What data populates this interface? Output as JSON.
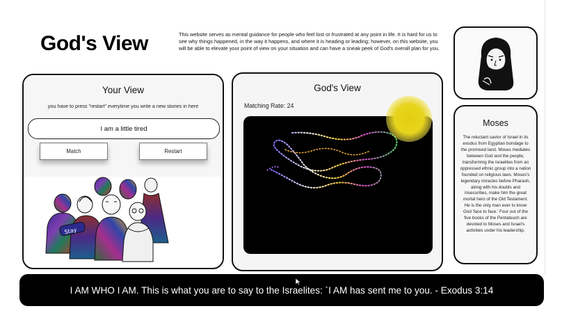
{
  "header": {
    "site_title": "God's View",
    "intro_text": "This website serves as mental guidance for people who feel lost or frustrated at any point in life. It is hard for us to see why things happened, in the way it happens, and where it is heading or leading; however, on this website, you will be able to elevate your point of view on your situation and can have a sneak peek of God's overall plan for you."
  },
  "your_view": {
    "title": "Your View",
    "instruction": "you have to press \"restart\" everytime you write a new stories in here",
    "story_input_value": "I am a little tired",
    "match_label": "Match",
    "restart_label": "Restart"
  },
  "gods_view": {
    "title": "God's View",
    "matching_rate_text": "Matching Rate: 24",
    "sun_color": "#e6d21a",
    "canvas_background": "#000000"
  },
  "character": {
    "name": "Moses",
    "description": "The reluctant savior of Israel in its exodus from Egyptian bondage to the promised land. Moses mediates between God and the people, transforming the Israelites from an oppressed ethnic group into a nation founded on religious laws. Moses's legendary miracles before Pharaoh, along with his doubts and insecurities, make him the great mortal hero of the Old Testament. He is the only man ever to know God 'face to face.' Four out of the five books of the Pentateuch are devoted to Moses and Israel's activities under his leadership.",
    "avatar_icon": "moses-portrait-icon"
  },
  "illustration": {
    "icon": "group-of-people-illustration",
    "sign_text": "Stay"
  },
  "quote": {
    "text": "I AM WHO I AM. This is what you are to say to the Israelites: `I AM has sent me to you. - Exodus 3:14"
  }
}
